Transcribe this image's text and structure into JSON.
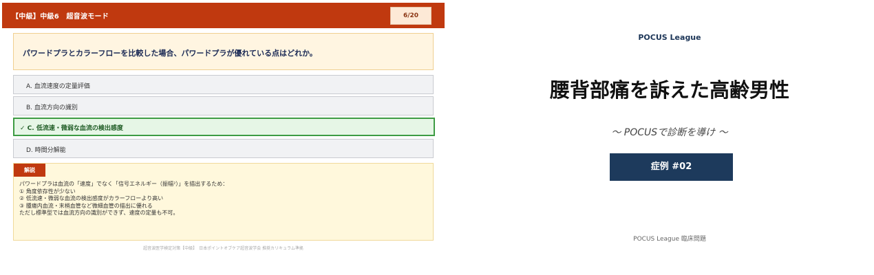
{
  "quiz": {
    "header_title": "【中級】中級6　超音波モード",
    "counter": "6/20",
    "question": "パワードプラとカラーフローを比較した場合、パワードプラが優れている点はどれか。",
    "options": [
      {
        "label": "A. 血流速度の定量評価",
        "correct": false
      },
      {
        "label": "B. 血流方向の識別",
        "correct": false
      },
      {
        "label": "✓ C. 低流速・微弱な血流の検出感度",
        "correct": true
      },
      {
        "label": "D. 時間分解能",
        "correct": false
      }
    ],
    "explanation": {
      "badge": "解説",
      "lines": [
        "パワードプラは血流の「速度」でなく「信号エネルギー（振幅²）」を描出するため：",
        "① 角度依存性が少ない",
        "② 低流速・微弱な血流の検出感度がカラーフローより高い",
        "③ 腫瘍内血流・末梢血管など微細血管の描出に優れる",
        "ただし標準型では血流方向の識別ができず、速度の定量も不可。"
      ]
    },
    "footer": "超音波医学検定対策【中級】　日本ポイントオブケア超音波学会 推奨カリキュラム準拠"
  },
  "card": {
    "brand": "POCUS League",
    "title": "腰背部痛を訴えた高齢男性",
    "subtitle": "〜 POCUSで診断を導け 〜",
    "case_label": "症例 #02",
    "footer": "POCUS League 臨床問題"
  },
  "colors": {
    "header": "#c0390f",
    "question_bg": "#fff5e1",
    "correct_border": "#3d9b43",
    "card_badge": "#1d3a5c"
  }
}
